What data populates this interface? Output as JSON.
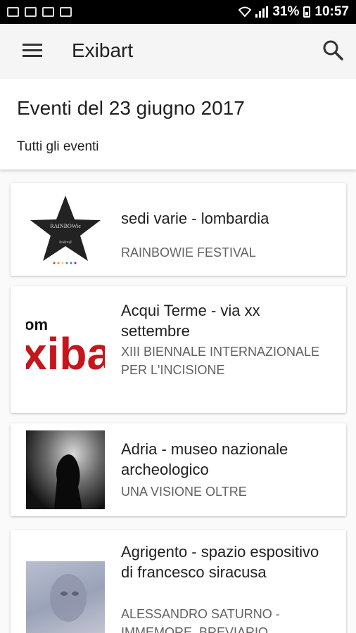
{
  "statusbar": {
    "battery": "31%",
    "time": "10:57"
  },
  "appbar": {
    "title": "Exibart"
  },
  "header": {
    "title": "Eventi del 23 giugno 2017",
    "filter": "Tutti gli eventi"
  },
  "events": [
    {
      "place": "sedi varie - lombardia",
      "name": "RAINBOWIE FESTIVAL",
      "thumb_text": "RAINBOWie",
      "thumb_sub": "festival"
    },
    {
      "place": "Acqui Terme - via xx settembre",
      "name": "XIII BIENNALE INTERNAZIONALE PER L'INCISIONE",
      "thumb_text": "xiba",
      "thumb_sub": "om"
    },
    {
      "place": "Adria - museo nazionale archeologico",
      "name": "UNA VISIONE OLTRE"
    },
    {
      "place": "Agrigento - spazio espositivo di francesco siracusa",
      "name": "ALESSANDRO SATURNO - IMMEMORE. BREVIARIO"
    }
  ]
}
